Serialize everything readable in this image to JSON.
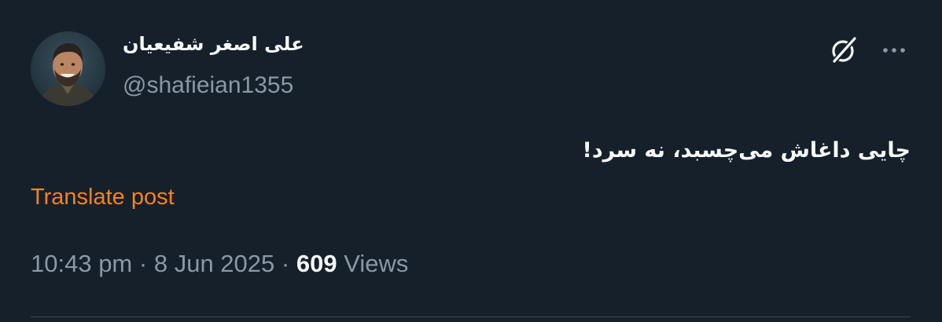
{
  "author": {
    "display_name": "علی اصغر شفیعیان",
    "handle": "@shafieian1355",
    "avatar_icon": "user-avatar"
  },
  "header_icons": {
    "grok": "grok-icon",
    "more": "more-icon"
  },
  "tweet": {
    "text": "چایی داغاش می‌چسبد، نه سرد!",
    "translate_label": "Translate post"
  },
  "meta": {
    "time": "10:43 pm",
    "date": "8 Jun 2025",
    "separator": "·",
    "views_count": "609",
    "views_label": "Views"
  },
  "colors": {
    "background": "#15202b",
    "text_primary": "#f7f9f9",
    "text_secondary": "#8b98a5",
    "link": "#f58220",
    "divider": "#38444d"
  }
}
